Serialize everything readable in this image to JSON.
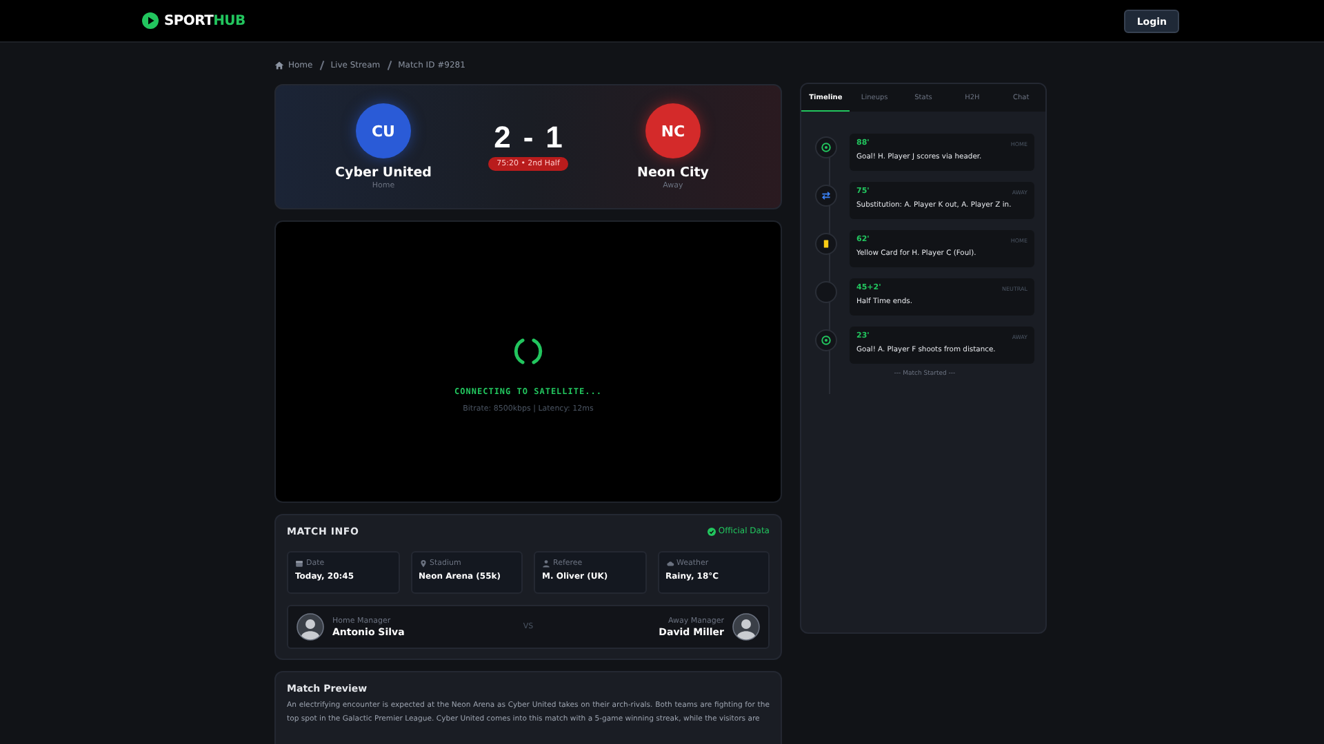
{
  "header": {
    "logo_main": "SPORT",
    "logo_accent": "HUB",
    "login": "Login"
  },
  "breadcrumb": [
    "Home",
    "Live Stream",
    "Match ID #9281"
  ],
  "match": {
    "home": {
      "abbr": "CU",
      "name": "Cyber United",
      "side": "Home"
    },
    "away": {
      "abbr": "NC",
      "name": "Neon City",
      "side": "Away"
    },
    "home_score": "2",
    "separator": "-",
    "away_score": "1",
    "status": "75:20 • 2nd Half"
  },
  "stream": {
    "message": "CONNECTING TO SATELLITE...",
    "stats": "Bitrate: 8500kbps | Latency: 12ms"
  },
  "match_info": {
    "title": "MATCH INFO",
    "badge": "Official Data",
    "details": [
      {
        "kind": "date",
        "label": "Date",
        "value": "Today, 20:45"
      },
      {
        "kind": "stadium",
        "label": "Stadium",
        "value": "Neon Arena (55k)"
      },
      {
        "kind": "referee",
        "label": "Referee",
        "value": "M. Oliver (UK)"
      },
      {
        "kind": "weather",
        "label": "Weather",
        "value": "Rainy, 18°C"
      }
    ],
    "home_manager": {
      "label": "Home Manager",
      "name": "Antonio Silva"
    },
    "vs": "VS",
    "away_manager": {
      "label": "Away Manager",
      "name": "David Miller"
    }
  },
  "preview": {
    "title": "Match Preview",
    "text": "An electrifying encounter is expected at the Neon Arena as Cyber United takes on their arch-rivals. Both teams are fighting for the top spot in the Galactic Premier League. Cyber United comes into this match with a 5-game winning streak, while the visitors are"
  },
  "tabs": [
    {
      "label": "Timeline",
      "selected": true
    },
    {
      "label": "Lineups",
      "selected": false
    },
    {
      "label": "Stats",
      "selected": false
    },
    {
      "label": "H2H",
      "selected": false
    },
    {
      "label": "Chat",
      "selected": false
    }
  ],
  "timeline": [
    {
      "kind": "goal",
      "minute": "88'",
      "team": "HOME",
      "text": "Goal! H. Player J scores via header."
    },
    {
      "kind": "substitution",
      "minute": "75'",
      "team": "AWAY",
      "text": "Substitution: A. Player K out, A. Player Z in."
    },
    {
      "kind": "card",
      "minute": "62'",
      "team": "HOME",
      "text": "Yellow Card for H. Player C (Foul)."
    },
    {
      "kind": "none",
      "minute": "45+2'",
      "team": "NEUTRAL",
      "text": "Half Time ends."
    },
    {
      "kind": "goal",
      "minute": "23'",
      "team": "AWAY",
      "text": "Goal! A. Player F shoots from distance."
    }
  ],
  "timeline_end": "--- Match Started ---"
}
